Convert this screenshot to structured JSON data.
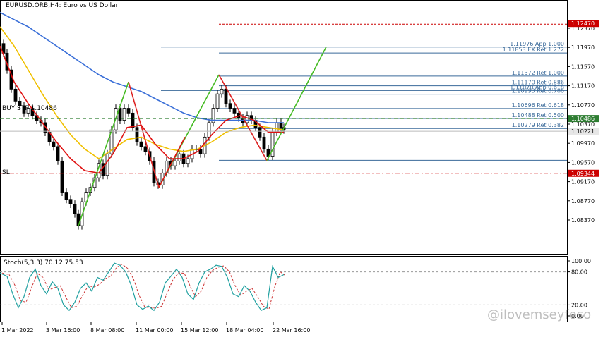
{
  "header": {
    "symbol_line": "EURUSD.ORB,H4:  Euro vs US Dollar"
  },
  "price_axis": {
    "ticks": [
      "1.12370",
      "1.11970",
      "1.11570",
      "1.11170",
      "1.10770",
      "1.10370",
      "1.09970",
      "1.09570",
      "1.09170",
      "1.08770",
      "1.08370"
    ]
  },
  "price_tags": [
    {
      "label": "1.12470",
      "color": "#cc0000",
      "text_color": "#ffffff",
      "price": 1.1247
    },
    {
      "label": "1.10486",
      "color": "#2e7d32",
      "text_color": "#ffffff",
      "price": 1.10486
    },
    {
      "label": "1.10221",
      "color": "#e6e6e6",
      "text_color": "#000000",
      "price": 1.10221
    },
    {
      "label": "1.09344",
      "color": "#cc0000",
      "text_color": "#ffffff",
      "price": 1.09344
    }
  ],
  "order_labels": {
    "buy_stop": "BUY STP 1.10486",
    "stop_loss": "SL"
  },
  "fibo_levels": [
    {
      "label": "1.11976 App 1.000",
      "price": 1.11976
    },
    {
      "label": "1.11853 EX Ret 1.272",
      "price": 1.11853
    },
    {
      "label": "1.11372 Ret 1.000",
      "price": 1.11372
    },
    {
      "label": "1.11170 Ret 0.886",
      "price": 1.1117
    },
    {
      "label": "1.11070 App 0.618",
      "price": 1.1107
    },
    {
      "label": "1.10993 Ret 0.786",
      "price": 1.10993
    },
    {
      "label": "1.10696 Ret 0.618",
      "price": 1.10696
    },
    {
      "label": "1.10488 Ret 0.500",
      "price": 1.10488
    },
    {
      "label": "1.10279 Ret 0.382",
      "price": 1.10279
    }
  ],
  "stoch_panel": {
    "title": "Stoch(5,3,3) 70.12 75.53",
    "ticks": [
      "100.00",
      "80.00",
      "20.00",
      "0.00"
    ]
  },
  "time_axis": {
    "labels": [
      "1 Mar 2022",
      "3 Mar 16:00",
      "8 Mar 08:00",
      "11 Mar 00:00",
      "15 Mar 12:00",
      "18 Mar 04:00",
      "22 Mar 16:00"
    ]
  },
  "watermark": "@ilovemseyfoso",
  "colors": {
    "ma_fast": "#e01010",
    "ma_mid": "#f0c000",
    "ma_slow": "#3a6fd8",
    "harmonic": "#44bb22",
    "harmonic_drop": "#dd2222",
    "fibo": "#3a6a9a",
    "stoch_main": "#20a0a0",
    "stoch_signal": "#cc3333"
  },
  "chart_data": {
    "type": "candlestick",
    "title": "EURUSD.ORB,H4:  Euro vs US Dollar",
    "ylim": [
      1.081,
      1.1252
    ],
    "stoch_ylim": [
      0,
      100
    ]
  }
}
